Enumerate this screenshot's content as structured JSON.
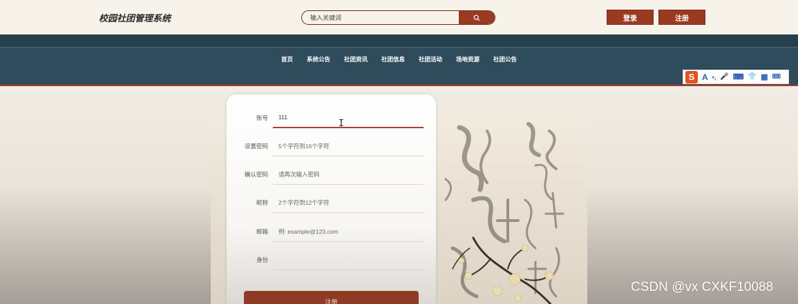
{
  "header": {
    "site_title": "校园社团管理系统",
    "search_placeholder": "输入关键词",
    "search_icon": "search-icon",
    "login_label": "登录",
    "register_label": "注册"
  },
  "nav": {
    "items": [
      "首页",
      "系统公告",
      "社团资讯",
      "社团信息",
      "社团活动",
      "场地资源",
      "社团公告"
    ]
  },
  "ime_toolbar": {
    "logo": "S",
    "glyphs": [
      "A",
      "•,",
      "🎤",
      "⌨",
      "👕",
      "▦",
      "🎟"
    ]
  },
  "form": {
    "fields": [
      {
        "label": "账号",
        "value": "111",
        "placeholder": ""
      },
      {
        "label": "设置密码",
        "value": "",
        "placeholder": "5个字符到16个字符"
      },
      {
        "label": "确认密码",
        "value": "",
        "placeholder": "请再次输入密码"
      },
      {
        "label": "昵称",
        "value": "",
        "placeholder": "2个字符到12个字符"
      },
      {
        "label": "邮箱",
        "value": "",
        "placeholder": "例: example@123.com"
      },
      {
        "label": "身份",
        "value": "",
        "placeholder": ""
      }
    ],
    "submit_label": "注册"
  },
  "watermark": "CSDN @vx  CXKF10088",
  "colors": {
    "accent": "#9a3a22",
    "nav_bg": "#2e4c5c",
    "page_bg": "#f3eee6"
  }
}
